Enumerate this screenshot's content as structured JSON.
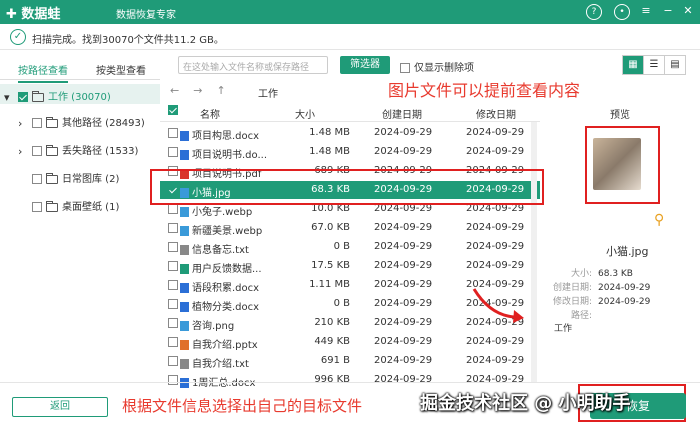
{
  "app": {
    "title": "数据蛙",
    "subtitle": "数据恢复专家"
  },
  "titlebar_icons": [
    "help-icon",
    "profile-icon",
    "menu-icon",
    "minimize-icon",
    "close-icon"
  ],
  "scan": {
    "status": "扫描完成。找到30070个文件共11.2 GB。"
  },
  "tabs": [
    {
      "label": "按路径查看"
    },
    {
      "label": "按类型查看"
    }
  ],
  "tree": [
    {
      "label": "工作 (30070)"
    },
    {
      "label": "其他路径 (28493)"
    },
    {
      "label": "丢失路径 (1533)"
    },
    {
      "label": "日常图库 (2)"
    },
    {
      "label": "桌面壁纸 (1)"
    }
  ],
  "toolbar": {
    "search_placeholder": "在这处输入文件名称或保存路径",
    "filter_label": "筛选器",
    "deleted_only_label": "仅显示删除项",
    "path": "工作"
  },
  "table": {
    "headers": [
      "名称",
      "大小",
      "创建日期",
      "修改日期"
    ],
    "rows": [
      {
        "name": "项目构思.docx",
        "size": "1.48 MB",
        "created": "2024-09-29",
        "modified": "2024-09-29",
        "icon": "word-icon"
      },
      {
        "name": "项目说明书.do...",
        "size": "1.48 MB",
        "created": "2024-09-29",
        "modified": "2024-09-29",
        "icon": "word-icon"
      },
      {
        "name": "项目说明书.pdf",
        "size": "689 KB",
        "created": "2024-09-29",
        "modified": "2024-09-29",
        "icon": "pdf-icon"
      },
      {
        "name": "小猫.jpg",
        "size": "68.3 KB",
        "created": "2024-09-29",
        "modified": "2024-09-29",
        "icon": "image-icon"
      },
      {
        "name": "小兔子.webp",
        "size": "10.0 KB",
        "created": "2024-09-29",
        "modified": "2024-09-29",
        "icon": "image-icon"
      },
      {
        "name": "新疆美景.webp",
        "size": "67.0 KB",
        "created": "2024-09-29",
        "modified": "2024-09-29",
        "icon": "image-icon"
      },
      {
        "name": "信息备忘.txt",
        "size": "0 B",
        "created": "2024-09-29",
        "modified": "2024-09-29",
        "icon": "text-icon"
      },
      {
        "name": "用户反馈数据...",
        "size": "17.5 KB",
        "created": "2024-09-29",
        "modified": "2024-09-29",
        "icon": "excel-icon"
      },
      {
        "name": "语段积累.docx",
        "size": "1.11 MB",
        "created": "2024-09-29",
        "modified": "2024-09-29",
        "icon": "word-icon"
      },
      {
        "name": "植物分类.docx",
        "size": "0 B",
        "created": "2024-09-29",
        "modified": "2024-09-29",
        "icon": "word-icon"
      },
      {
        "name": "咨询.png",
        "size": "210 KB",
        "created": "2024-09-29",
        "modified": "2024-09-29",
        "icon": "image-icon"
      },
      {
        "name": "自我介绍.pptx",
        "size": "449 KB",
        "created": "2024-09-29",
        "modified": "2024-09-29",
        "icon": "ppt-icon"
      },
      {
        "name": "自我介绍.txt",
        "size": "691 B",
        "created": "2024-09-29",
        "modified": "2024-09-29",
        "icon": "text-icon"
      },
      {
        "name": "1周汇总.docx",
        "size": "996 KB",
        "created": "2024-09-29",
        "modified": "2024-09-29",
        "icon": "word-icon"
      }
    ]
  },
  "preview": {
    "title": "预览",
    "filename": "小猫.jpg",
    "size_label": "大小:",
    "size": "68.3 KB",
    "created_label": "创建日期:",
    "created": "2024-09-29",
    "modified_label": "修改日期:",
    "modified": "2024-09-29",
    "path_label": "路径:",
    "path": "工作"
  },
  "annotations": {
    "top": "图片文件可以提前查看内容",
    "bottom": "根据文件信息选择出自己的目标文件",
    "watermark": "掘金技术社区 @ 小明助手"
  },
  "footer": {
    "back_label": "返回",
    "recover_label": "恢复"
  },
  "colors": {
    "accent": "#1f9b78",
    "annotation": "#e83a2e"
  }
}
